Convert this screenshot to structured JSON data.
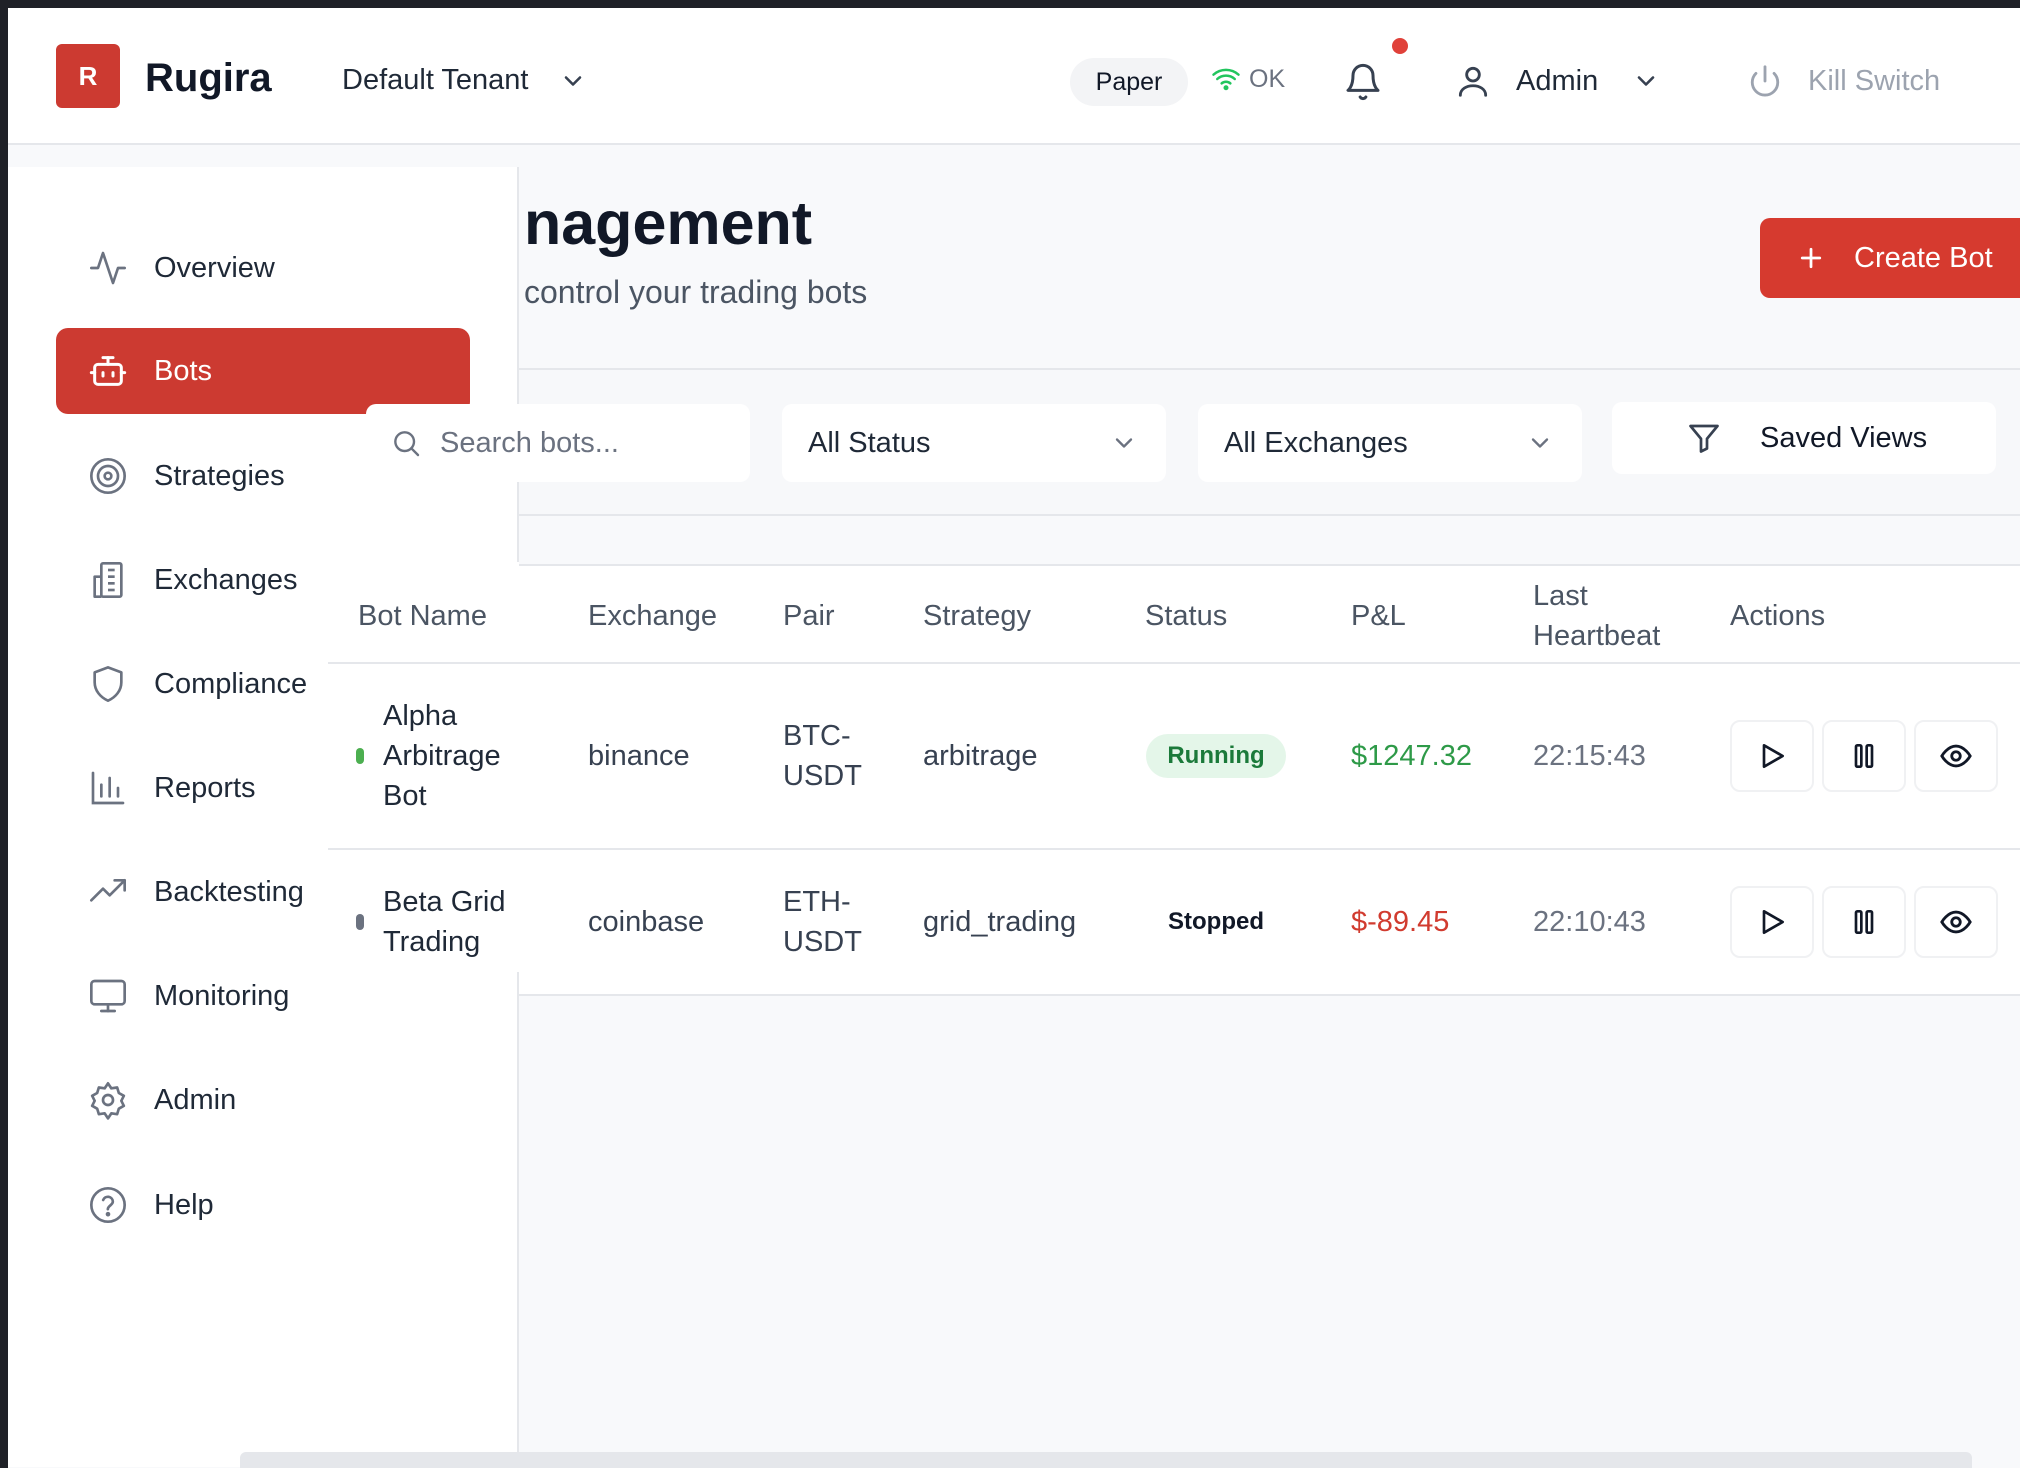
{
  "app": {
    "logo_letter": "R",
    "name": "Rugira"
  },
  "header": {
    "tenant": "Default Tenant",
    "mode": "Paper",
    "connection": "OK",
    "user": "Admin",
    "kill_switch": "Kill Switch"
  },
  "sidebar": {
    "items": [
      {
        "label": "Overview",
        "icon": "activity-icon"
      },
      {
        "label": "Bots",
        "icon": "bot-icon",
        "active": true
      },
      {
        "label": "Strategies",
        "icon": "target-icon"
      },
      {
        "label": "Exchanges",
        "icon": "building-icon"
      },
      {
        "label": "Compliance",
        "icon": "shield-icon"
      },
      {
        "label": "Reports",
        "icon": "bar-chart-icon"
      },
      {
        "label": "Backtesting",
        "icon": "trending-up-icon"
      },
      {
        "label": "Monitoring",
        "icon": "monitor-icon"
      },
      {
        "label": "Admin",
        "icon": "gear-icon"
      },
      {
        "label": "Help",
        "icon": "help-icon"
      }
    ]
  },
  "page": {
    "title": "nagement",
    "subtitle": "control your trading bots",
    "create_label": "Create Bot"
  },
  "filters": {
    "search_placeholder": "Search bots...",
    "status_value": "All Status",
    "exchange_value": "All Exchanges",
    "saved_views": "Saved Views"
  },
  "table": {
    "headers": {
      "name": "Bot Name",
      "exchange": "Exchange",
      "pair": "Pair",
      "strategy": "Strategy",
      "status": "Status",
      "pnl": "P&L",
      "heartbeat_1": "Last",
      "heartbeat_2": "Heartbeat",
      "actions": "Actions"
    },
    "rows": [
      {
        "name_1": "Alpha",
        "name_2": "Arbitrage",
        "name_3": "Bot",
        "exchange": "binance",
        "pair_1": "BTC-",
        "pair_2": "USDT",
        "strategy": "arbitrage",
        "status": "Running",
        "pnl": "$1247.32",
        "heartbeat": "22:15:43",
        "status_color": "#4caf50",
        "pnl_color": "#2e9a48"
      },
      {
        "name_1": "Beta Grid",
        "name_2": "Trading",
        "exchange": "coinbase",
        "pair_1": "ETH-",
        "pair_2": "USDT",
        "strategy": "grid_trading",
        "status": "Stopped",
        "pnl": "$-89.45",
        "heartbeat": "22:10:43",
        "status_color": "#6b7280",
        "pnl_color": "#d13b2f"
      }
    ]
  },
  "colors": {
    "accent": "#cc3a31",
    "button": "#d63a2f",
    "notif": "#e0413a",
    "ok": "#22c55e"
  }
}
